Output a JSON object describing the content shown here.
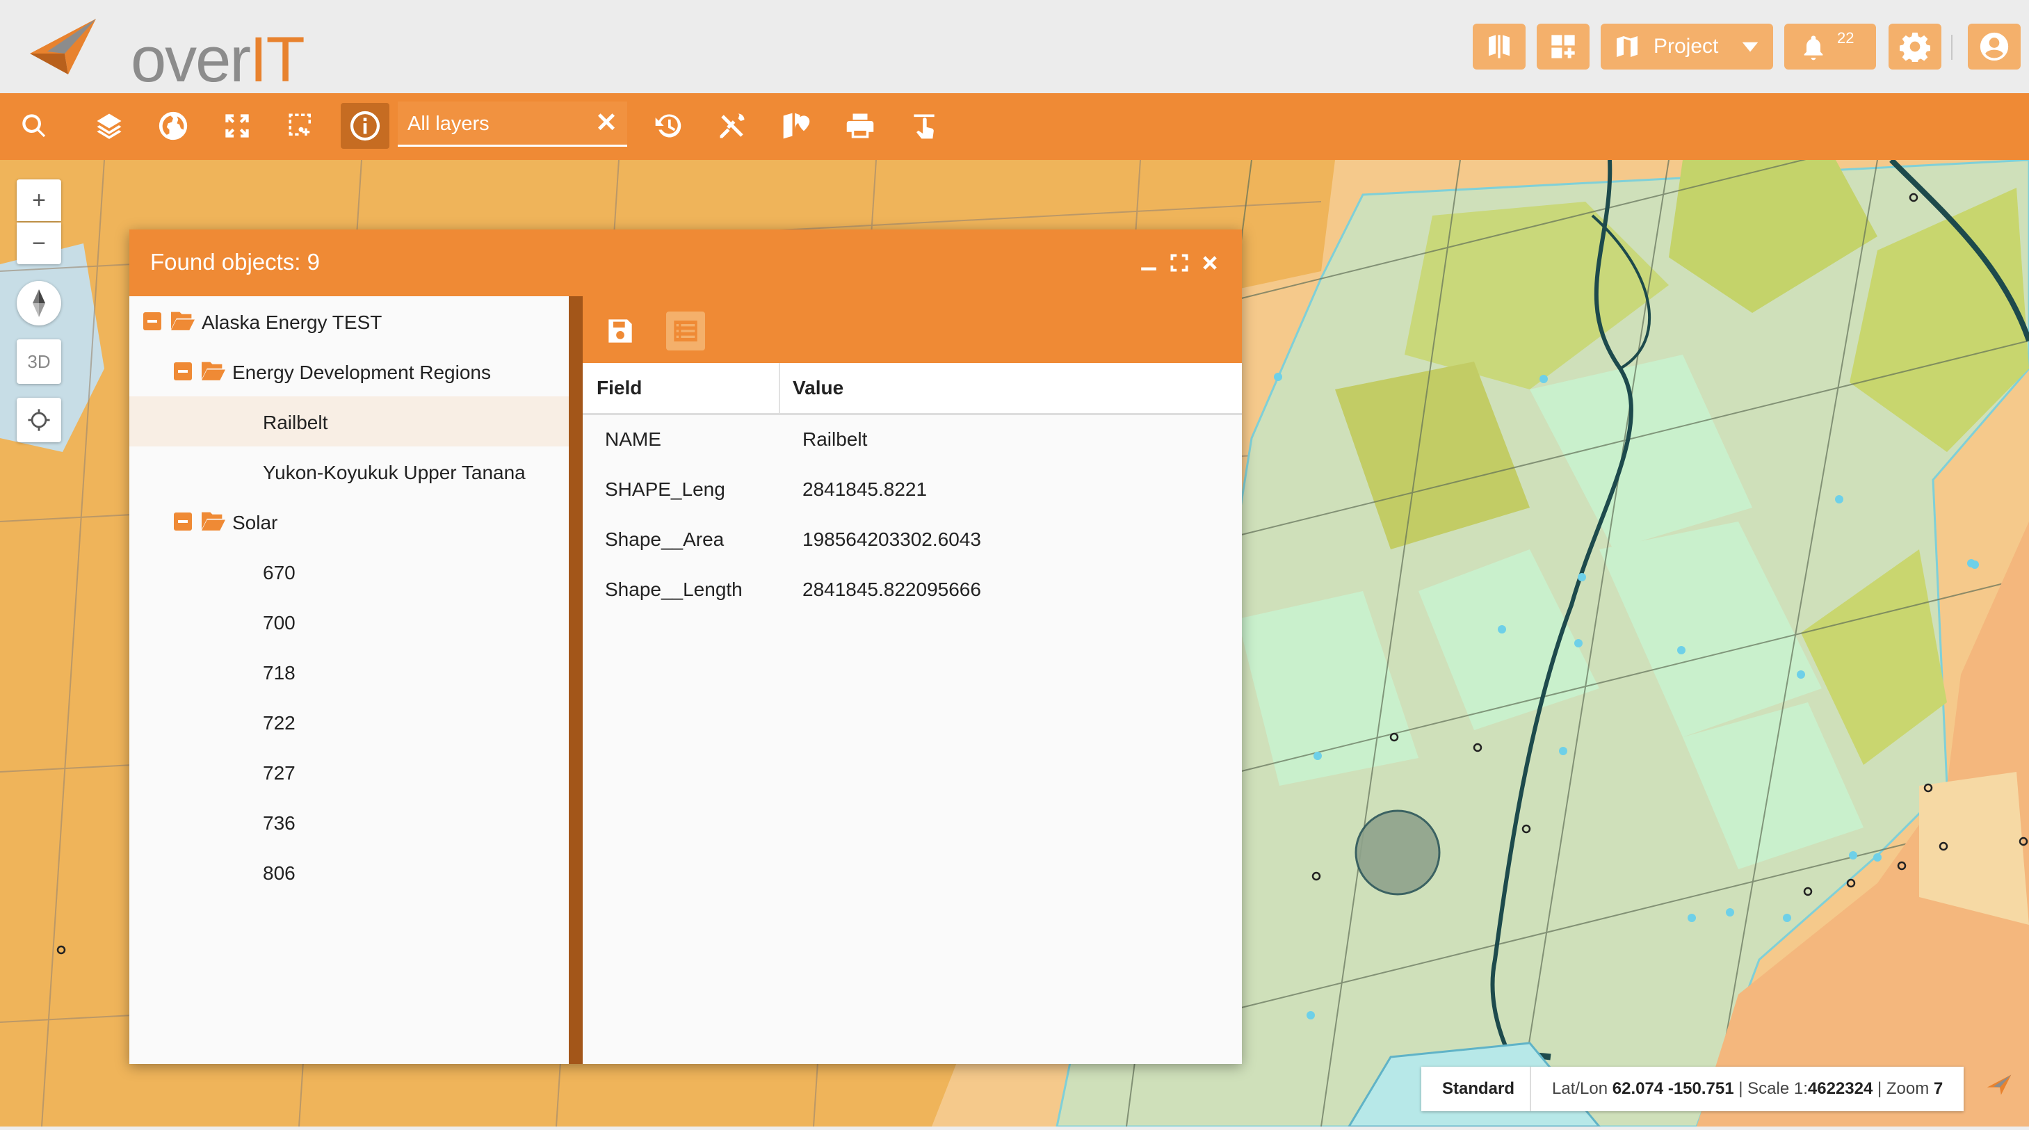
{
  "app": {
    "logo_text": "over",
    "logo_accent": "IT"
  },
  "header": {
    "project_label": "Project",
    "notification_count": "22",
    "brand_color": "#ef8a35",
    "button_color": "#f4b06b"
  },
  "toolbar": {
    "layer_filter_value": "All layers",
    "clear_label": "✕"
  },
  "map_controls": {
    "zoom_in": "+",
    "zoom_out": "−",
    "view_3d": "3D"
  },
  "panel": {
    "title": "Found objects: 9",
    "tree": {
      "root": "Alaska Energy TEST",
      "groups": [
        {
          "label": "Energy Development Regions",
          "items": [
            "Railbelt",
            "Yukon-Koyukuk Upper Tanana"
          ]
        },
        {
          "label": "Solar",
          "items": [
            "670",
            "700",
            "718",
            "722",
            "727",
            "736",
            "806"
          ]
        }
      ],
      "selected": "Railbelt"
    },
    "details": {
      "headers": {
        "field": "Field",
        "value": "Value"
      },
      "rows": [
        {
          "field": "NAME",
          "value": "Railbelt"
        },
        {
          "field": "SHAPE_Leng",
          "value": "2841845.8221"
        },
        {
          "field": "Shape__Area",
          "value": "198564203302.6043"
        },
        {
          "field": "Shape__Length",
          "value": "2841845.822095666"
        }
      ]
    }
  },
  "status": {
    "mode": "Standard",
    "latlon_label": "Lat/Lon",
    "latlon_value": "62.074 -150.751",
    "scale_label": "Scale 1:",
    "scale_value": "4622324",
    "zoom_label": "Zoom",
    "zoom_value": "7"
  }
}
